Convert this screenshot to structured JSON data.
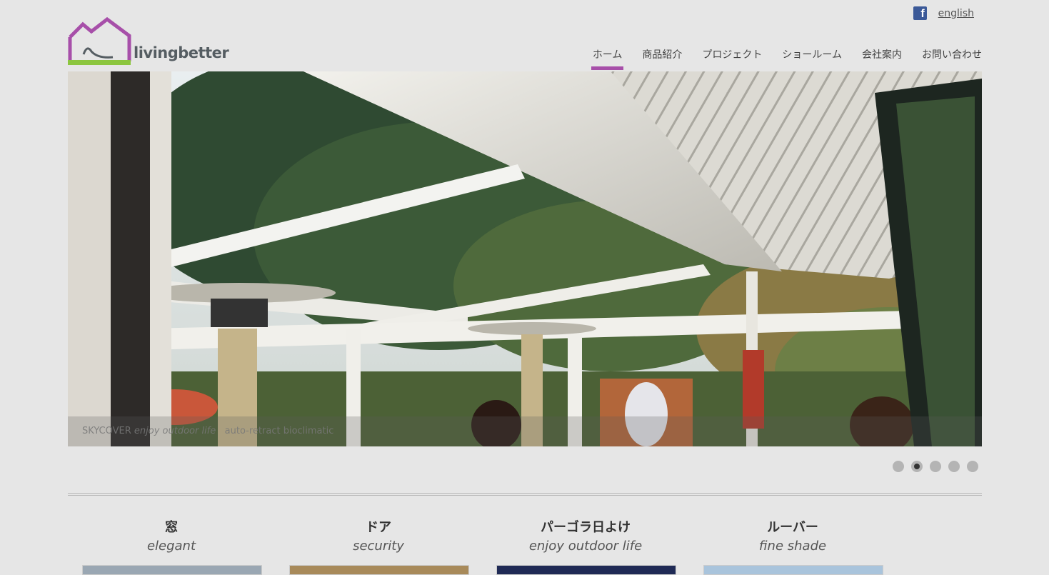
{
  "topbar": {
    "lang_label": "english"
  },
  "logo": {
    "text": "livingbetter"
  },
  "nav": [
    {
      "label": "ホーム",
      "active": true
    },
    {
      "label": "商品紹介"
    },
    {
      "label": "プロジェクト"
    },
    {
      "label": "ショールーム"
    },
    {
      "label": "会社案内"
    },
    {
      "label": "お問い合わせ"
    }
  ],
  "hero": {
    "caption_brand": "SKYCOVER",
    "caption_tagline": "enjoy outdoor life",
    "caption_extra": "auto-retract bioclimatic",
    "active_slide": 2,
    "slide_count": 5
  },
  "categories": [
    {
      "title": "窓",
      "subtitle": "elegant",
      "thumb_color": "#9aa7b3"
    },
    {
      "title": "ドア",
      "subtitle": "security",
      "thumb_color": "#a88a5a"
    },
    {
      "title": "パーゴラ日よけ",
      "subtitle": "enjoy outdoor life",
      "thumb_color": "#1f2a55"
    },
    {
      "title": "ルーバー",
      "subtitle": "fine shade",
      "thumb_color": "#a9c4dc"
    }
  ],
  "colors": {
    "accent_purple": "#a74fa9",
    "accent_green": "#8cc63f",
    "facebook": "#3b5998"
  }
}
